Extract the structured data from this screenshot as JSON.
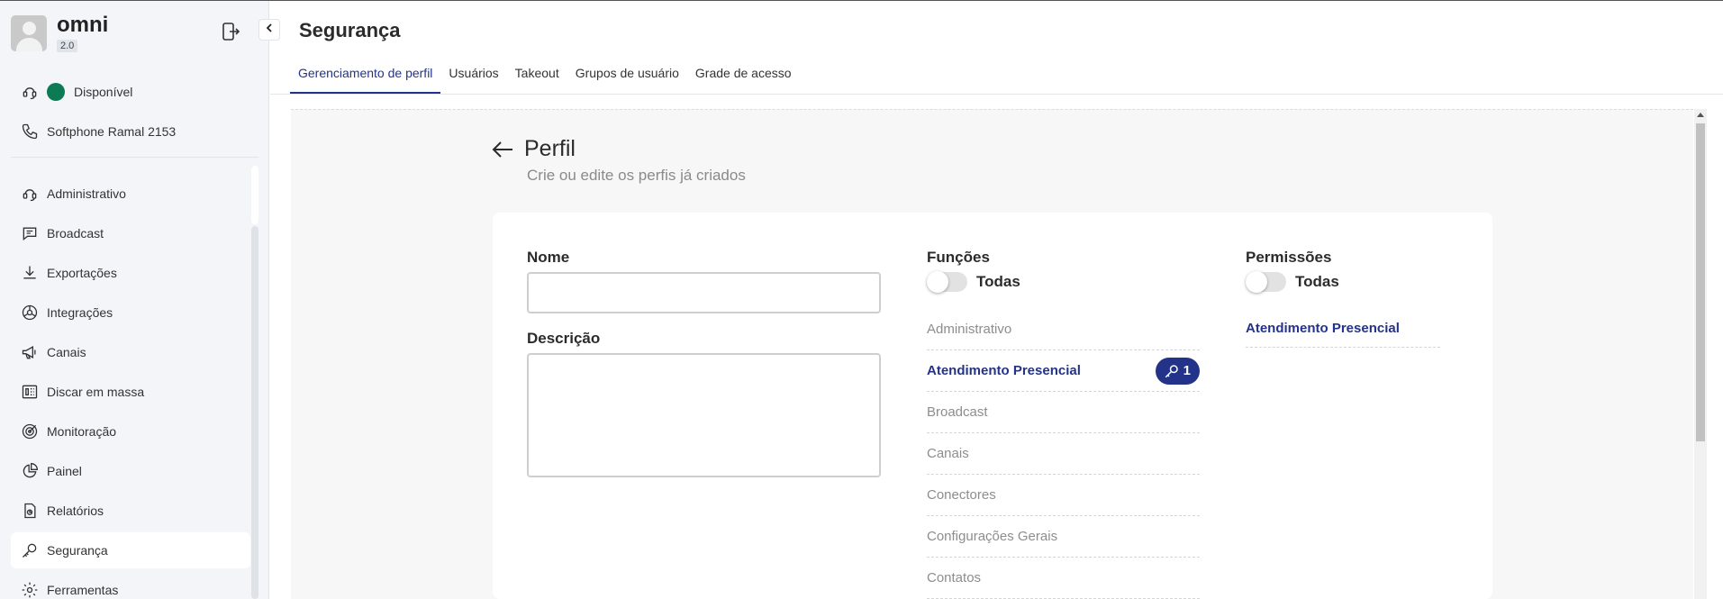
{
  "app": {
    "name": "omni",
    "version": "2.0"
  },
  "status": {
    "availability": "Disponível",
    "availability_color": "#0c7a52",
    "softphone": "Softphone Ramal 2153"
  },
  "sidebar": {
    "items": [
      {
        "label": "Administrativo",
        "icon": "headset-icon"
      },
      {
        "label": "Broadcast",
        "icon": "chat-bubble-icon"
      },
      {
        "label": "Exportações",
        "icon": "download-icon"
      },
      {
        "label": "Integrações",
        "icon": "integration-icon"
      },
      {
        "label": "Canais",
        "icon": "megaphone-icon"
      },
      {
        "label": "Discar em massa",
        "icon": "dial-icon"
      },
      {
        "label": "Monitoração",
        "icon": "target-icon"
      },
      {
        "label": "Painel",
        "icon": "pie-chart-icon"
      },
      {
        "label": "Relatórios",
        "icon": "report-icon"
      },
      {
        "label": "Segurança",
        "icon": "key-icon"
      },
      {
        "label": "Ferramentas",
        "icon": "gear-icon"
      }
    ],
    "active": "Segurança"
  },
  "header": {
    "title": "Segurança",
    "tabs": [
      {
        "label": "Gerenciamento de perfil"
      },
      {
        "label": "Usuários"
      },
      {
        "label": "Takeout"
      },
      {
        "label": "Grupos de usuário"
      },
      {
        "label": "Grade de acesso"
      }
    ]
  },
  "profile_section": {
    "title": "Perfil",
    "subtitle": "Crie ou edite os perfis já criados"
  },
  "form": {
    "name_label": "Nome",
    "name_value": "",
    "description_label": "Descrição",
    "description_value": ""
  },
  "functions": {
    "title": "Funções",
    "toggle_all": "Todas",
    "items": [
      {
        "label": "Administrativo"
      },
      {
        "label": "Atendimento Presencial",
        "badge": "1"
      },
      {
        "label": "Broadcast"
      },
      {
        "label": "Canais"
      },
      {
        "label": "Conectores"
      },
      {
        "label": "Configurações Gerais"
      },
      {
        "label": "Contatos"
      }
    ]
  },
  "permissions": {
    "title": "Permissões",
    "toggle_all": "Todas",
    "items": [
      {
        "label": "Atendimento Presencial"
      }
    ]
  },
  "colors": {
    "accent": "#24338a",
    "sidebar_bg": "#f3f5f8"
  }
}
